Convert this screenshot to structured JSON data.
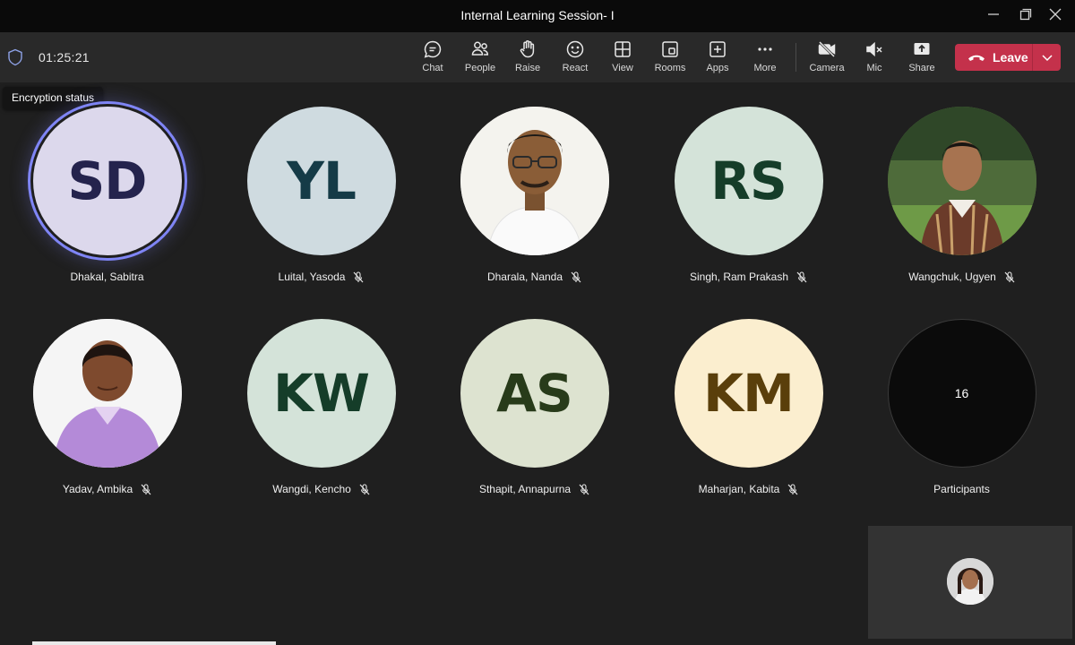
{
  "window": {
    "title": "Internal Learning Session- I"
  },
  "toolbar": {
    "timer": "01:25:21",
    "encryption_tooltip": "Encryption status",
    "buttons": [
      {
        "label": "Chat",
        "icon": "chat-icon"
      },
      {
        "label": "People",
        "icon": "people-icon"
      },
      {
        "label": "Raise",
        "icon": "raise-hand-icon"
      },
      {
        "label": "React",
        "icon": "react-icon"
      },
      {
        "label": "View",
        "icon": "view-icon"
      },
      {
        "label": "Rooms",
        "icon": "rooms-icon"
      },
      {
        "label": "Apps",
        "icon": "apps-icon"
      },
      {
        "label": "More",
        "icon": "more-icon"
      },
      {
        "label": "Camera",
        "icon": "camera-off-icon"
      },
      {
        "label": "Mic",
        "icon": "mic-muted-icon"
      },
      {
        "label": "Share",
        "icon": "share-icon"
      }
    ],
    "leave_label": "Leave"
  },
  "participants": [
    {
      "name": "Dhakal, Sabitra",
      "initials": "SD",
      "muted": false,
      "speaking": true,
      "avatar_bg": "#dcd8ec",
      "initials_color": "#24234d"
    },
    {
      "name": "Luital, Yasoda",
      "initials": "YL",
      "muted": true,
      "avatar_bg": "#cfdbe0",
      "initials_color": "#153b47"
    },
    {
      "name": "Dharala, Nanda",
      "initials": "",
      "muted": true,
      "photo": "man-photo"
    },
    {
      "name": "Singh, Ram Prakash",
      "initials": "RS",
      "muted": true,
      "avatar_bg": "#d4e3d9",
      "initials_color": "#153d29"
    },
    {
      "name": "Wangchuk, Ugyen",
      "initials": "",
      "muted": true,
      "photo": "man-outdoor-photo"
    },
    {
      "name": "Yadav, Ambika",
      "initials": "",
      "muted": true,
      "photo": "woman-photo"
    },
    {
      "name": "Wangdi, Kencho",
      "initials": "KW",
      "muted": true,
      "avatar_bg": "#d4e3d9",
      "initials_color": "#153d29"
    },
    {
      "name": "Sthapit, Annapurna",
      "initials": "AS",
      "muted": true,
      "avatar_bg": "#dde3d0",
      "initials_color": "#283b1a"
    },
    {
      "name": "Maharjan, Kabita",
      "initials": "KM",
      "muted": true,
      "avatar_bg": "#fbeecf",
      "initials_color": "#5a3f0b"
    }
  ],
  "overflow": {
    "count": "16",
    "label": "Participants"
  },
  "colors": {
    "accent": "#7f85f5",
    "leave": "#c4314b",
    "background": "#1f1f1f"
  }
}
